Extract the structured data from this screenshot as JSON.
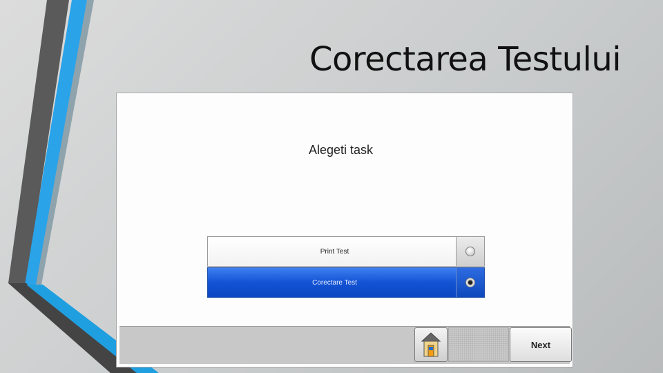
{
  "slide": {
    "title": "Corectarea Testului"
  },
  "screen": {
    "heading": "Alegeti task",
    "options": [
      {
        "label": "Print Test",
        "selected": false
      },
      {
        "label": "Corectare Test",
        "selected": true
      }
    ],
    "toolbar": {
      "home_icon": "home-icon",
      "next_label": "Next"
    }
  },
  "colors": {
    "accent_blue": "#1353d4",
    "deco_blue": "#29a3e6",
    "deco_gray": "#555555"
  }
}
